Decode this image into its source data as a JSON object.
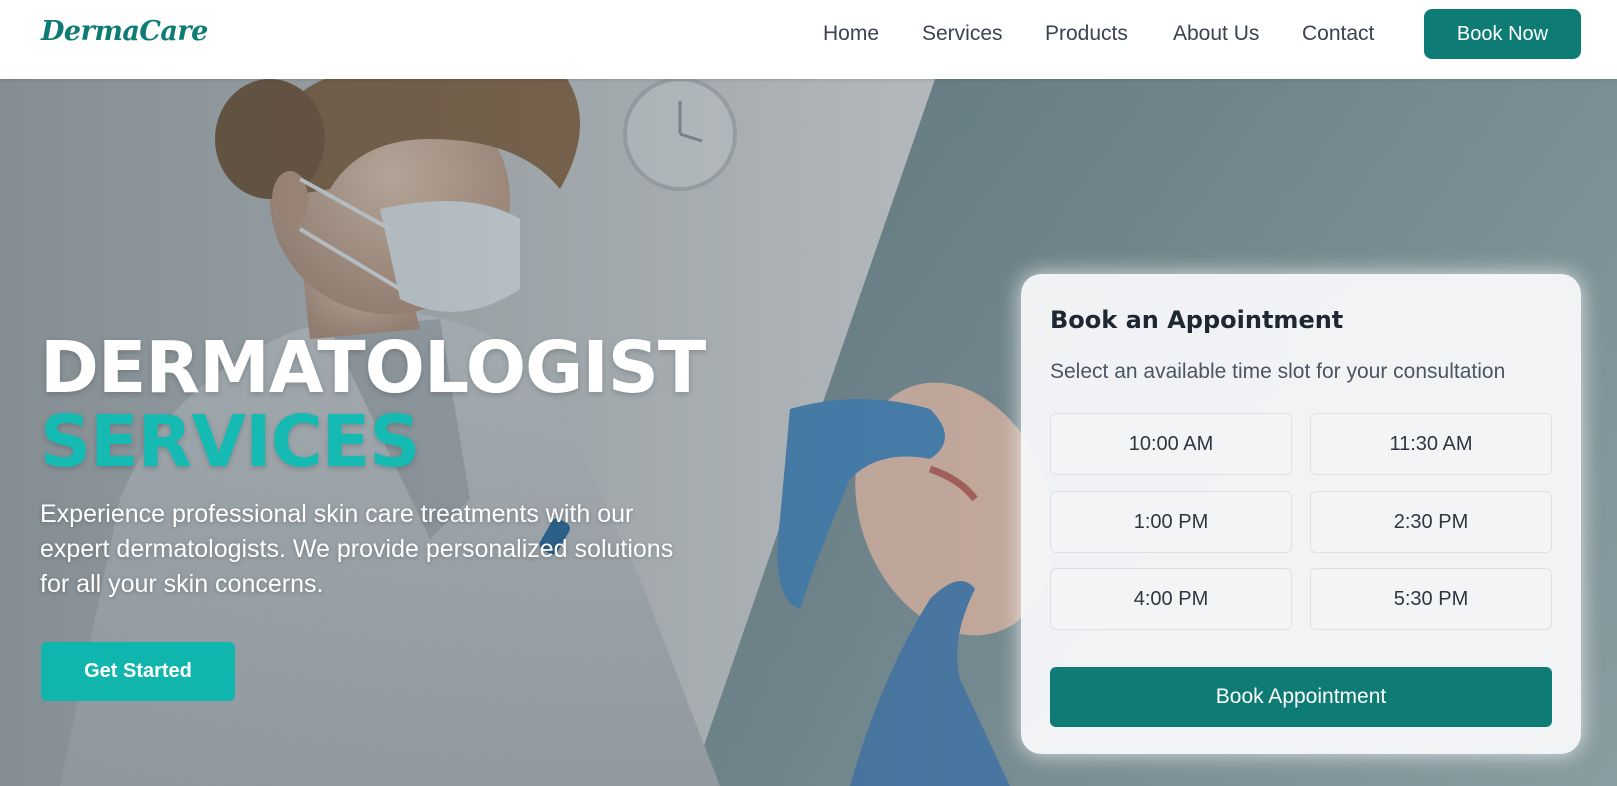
{
  "brand": {
    "logo_text": "DermaCare",
    "primary_color": "#0e7c74",
    "accent_color": "#15bab3"
  },
  "nav": {
    "items": [
      {
        "label": "Home"
      },
      {
        "label": "Services"
      },
      {
        "label": "Products"
      },
      {
        "label": "About Us"
      },
      {
        "label": "Contact"
      }
    ],
    "cta_label": "Book Now"
  },
  "hero": {
    "title_line1": "DERMATOLOGIST",
    "title_line2": "SERVICES",
    "description": "Experience professional skin care treatments with our expert dermatologists. We provide personalized solutions for all your skin concerns.",
    "cta_label": "Get Started",
    "background_image": "dermatologist-treating-patient-photo"
  },
  "appointment": {
    "title": "Book an Appointment",
    "subtitle": "Select an available time slot for your consultation",
    "slots": [
      "10:00 AM",
      "11:30 AM",
      "1:00 PM",
      "2:30 PM",
      "4:00 PM",
      "5:30 PM"
    ],
    "submit_label": "Book Appointment"
  }
}
